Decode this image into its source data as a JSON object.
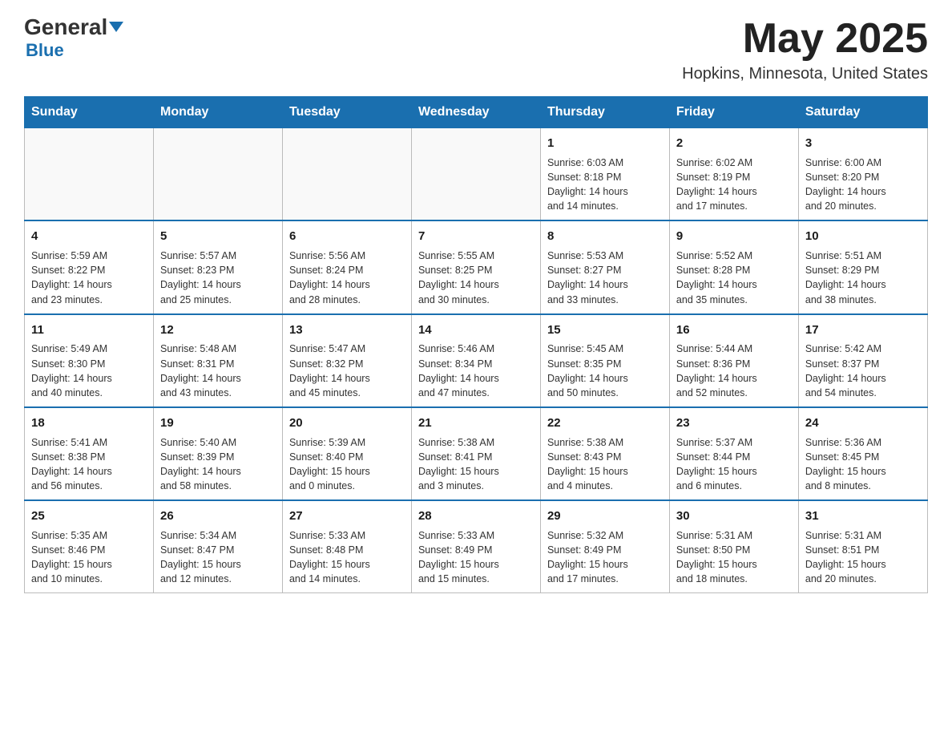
{
  "header": {
    "logo_general": "General",
    "logo_blue": "Blue",
    "month_year": "May 2025",
    "location": "Hopkins, Minnesota, United States"
  },
  "weekdays": [
    "Sunday",
    "Monday",
    "Tuesday",
    "Wednesday",
    "Thursday",
    "Friday",
    "Saturday"
  ],
  "rows": [
    [
      {
        "day": "",
        "info": ""
      },
      {
        "day": "",
        "info": ""
      },
      {
        "day": "",
        "info": ""
      },
      {
        "day": "",
        "info": ""
      },
      {
        "day": "1",
        "info": "Sunrise: 6:03 AM\nSunset: 8:18 PM\nDaylight: 14 hours\nand 14 minutes."
      },
      {
        "day": "2",
        "info": "Sunrise: 6:02 AM\nSunset: 8:19 PM\nDaylight: 14 hours\nand 17 minutes."
      },
      {
        "day": "3",
        "info": "Sunrise: 6:00 AM\nSunset: 8:20 PM\nDaylight: 14 hours\nand 20 minutes."
      }
    ],
    [
      {
        "day": "4",
        "info": "Sunrise: 5:59 AM\nSunset: 8:22 PM\nDaylight: 14 hours\nand 23 minutes."
      },
      {
        "day": "5",
        "info": "Sunrise: 5:57 AM\nSunset: 8:23 PM\nDaylight: 14 hours\nand 25 minutes."
      },
      {
        "day": "6",
        "info": "Sunrise: 5:56 AM\nSunset: 8:24 PM\nDaylight: 14 hours\nand 28 minutes."
      },
      {
        "day": "7",
        "info": "Sunrise: 5:55 AM\nSunset: 8:25 PM\nDaylight: 14 hours\nand 30 minutes."
      },
      {
        "day": "8",
        "info": "Sunrise: 5:53 AM\nSunset: 8:27 PM\nDaylight: 14 hours\nand 33 minutes."
      },
      {
        "day": "9",
        "info": "Sunrise: 5:52 AM\nSunset: 8:28 PM\nDaylight: 14 hours\nand 35 minutes."
      },
      {
        "day": "10",
        "info": "Sunrise: 5:51 AM\nSunset: 8:29 PM\nDaylight: 14 hours\nand 38 minutes."
      }
    ],
    [
      {
        "day": "11",
        "info": "Sunrise: 5:49 AM\nSunset: 8:30 PM\nDaylight: 14 hours\nand 40 minutes."
      },
      {
        "day": "12",
        "info": "Sunrise: 5:48 AM\nSunset: 8:31 PM\nDaylight: 14 hours\nand 43 minutes."
      },
      {
        "day": "13",
        "info": "Sunrise: 5:47 AM\nSunset: 8:32 PM\nDaylight: 14 hours\nand 45 minutes."
      },
      {
        "day": "14",
        "info": "Sunrise: 5:46 AM\nSunset: 8:34 PM\nDaylight: 14 hours\nand 47 minutes."
      },
      {
        "day": "15",
        "info": "Sunrise: 5:45 AM\nSunset: 8:35 PM\nDaylight: 14 hours\nand 50 minutes."
      },
      {
        "day": "16",
        "info": "Sunrise: 5:44 AM\nSunset: 8:36 PM\nDaylight: 14 hours\nand 52 minutes."
      },
      {
        "day": "17",
        "info": "Sunrise: 5:42 AM\nSunset: 8:37 PM\nDaylight: 14 hours\nand 54 minutes."
      }
    ],
    [
      {
        "day": "18",
        "info": "Sunrise: 5:41 AM\nSunset: 8:38 PM\nDaylight: 14 hours\nand 56 minutes."
      },
      {
        "day": "19",
        "info": "Sunrise: 5:40 AM\nSunset: 8:39 PM\nDaylight: 14 hours\nand 58 minutes."
      },
      {
        "day": "20",
        "info": "Sunrise: 5:39 AM\nSunset: 8:40 PM\nDaylight: 15 hours\nand 0 minutes."
      },
      {
        "day": "21",
        "info": "Sunrise: 5:38 AM\nSunset: 8:41 PM\nDaylight: 15 hours\nand 3 minutes."
      },
      {
        "day": "22",
        "info": "Sunrise: 5:38 AM\nSunset: 8:43 PM\nDaylight: 15 hours\nand 4 minutes."
      },
      {
        "day": "23",
        "info": "Sunrise: 5:37 AM\nSunset: 8:44 PM\nDaylight: 15 hours\nand 6 minutes."
      },
      {
        "day": "24",
        "info": "Sunrise: 5:36 AM\nSunset: 8:45 PM\nDaylight: 15 hours\nand 8 minutes."
      }
    ],
    [
      {
        "day": "25",
        "info": "Sunrise: 5:35 AM\nSunset: 8:46 PM\nDaylight: 15 hours\nand 10 minutes."
      },
      {
        "day": "26",
        "info": "Sunrise: 5:34 AM\nSunset: 8:47 PM\nDaylight: 15 hours\nand 12 minutes."
      },
      {
        "day": "27",
        "info": "Sunrise: 5:33 AM\nSunset: 8:48 PM\nDaylight: 15 hours\nand 14 minutes."
      },
      {
        "day": "28",
        "info": "Sunrise: 5:33 AM\nSunset: 8:49 PM\nDaylight: 15 hours\nand 15 minutes."
      },
      {
        "day": "29",
        "info": "Sunrise: 5:32 AM\nSunset: 8:49 PM\nDaylight: 15 hours\nand 17 minutes."
      },
      {
        "day": "30",
        "info": "Sunrise: 5:31 AM\nSunset: 8:50 PM\nDaylight: 15 hours\nand 18 minutes."
      },
      {
        "day": "31",
        "info": "Sunrise: 5:31 AM\nSunset: 8:51 PM\nDaylight: 15 hours\nand 20 minutes."
      }
    ]
  ]
}
